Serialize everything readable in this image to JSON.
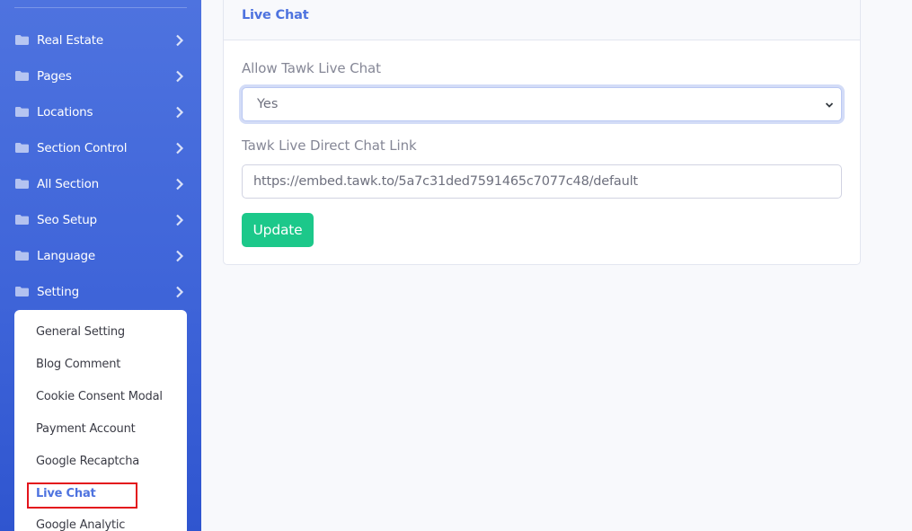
{
  "sidebar": {
    "items": [
      {
        "label": "Real Estate",
        "icon": "folder-icon"
      },
      {
        "label": "Pages",
        "icon": "folder-icon"
      },
      {
        "label": "Locations",
        "icon": "folder-icon"
      },
      {
        "label": "Section Control",
        "icon": "folder-icon"
      },
      {
        "label": "All Section",
        "icon": "folder-icon"
      },
      {
        "label": "Seo Setup",
        "icon": "folder-icon"
      },
      {
        "label": "Language",
        "icon": "folder-icon"
      },
      {
        "label": "Setting",
        "icon": "folder-icon"
      }
    ],
    "setting_submenu": [
      {
        "label": "General Setting"
      },
      {
        "label": "Blog Comment"
      },
      {
        "label": "Cookie Consent Modal"
      },
      {
        "label": "Payment Account"
      },
      {
        "label": "Google Recaptcha"
      },
      {
        "label": "Live Chat",
        "active": true
      },
      {
        "label": "Google Analytic"
      }
    ]
  },
  "card": {
    "title": "Live Chat",
    "allow_label": "Allow Tawk Live Chat",
    "allow_value": "Yes",
    "link_label": "Tawk Live Direct Chat Link",
    "link_value": "https://embed.tawk.to/5a7c31ded7591465c7077c48/default",
    "update_label": "Update"
  },
  "colors": {
    "sidebar": "#4e73df",
    "primary": "#4e73df",
    "success": "#1cc88a",
    "highlight": "#e3141c"
  }
}
